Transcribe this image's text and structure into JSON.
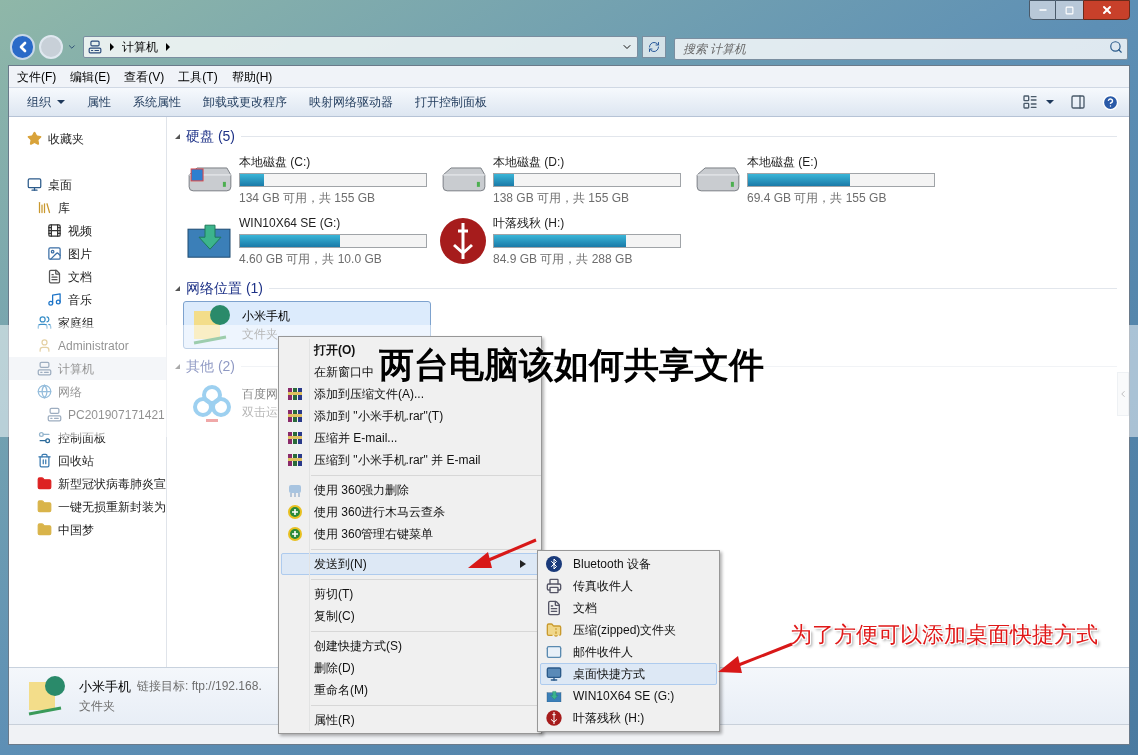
{
  "address": {
    "path": [
      "计算机"
    ]
  },
  "search": {
    "placeholder": "搜索 计算机"
  },
  "menu": [
    "文件(F)",
    "编辑(E)",
    "查看(V)",
    "工具(T)",
    "帮助(H)"
  ],
  "toolbar": [
    {
      "label": "组织",
      "kind": "dropdown"
    },
    {
      "label": "属性",
      "kind": "button"
    },
    {
      "label": "系统属性",
      "kind": "button"
    },
    {
      "label": "卸载或更改程序",
      "kind": "button"
    },
    {
      "label": "映射网络驱动器",
      "kind": "button"
    },
    {
      "label": "打开控制面板",
      "kind": "button"
    }
  ],
  "sidebar": {
    "items": [
      {
        "label": "收藏夹",
        "kind": "favorites",
        "selected": false
      },
      {
        "label": "桌面",
        "kind": "desktop",
        "selected": false,
        "children": [
          {
            "label": "库",
            "kind": "library",
            "selected": false,
            "children": [
              {
                "label": "视频",
                "kind": "video",
                "selected": false
              },
              {
                "label": "图片",
                "kind": "picture",
                "selected": false
              },
              {
                "label": "文档",
                "kind": "document",
                "selected": false
              },
              {
                "label": "音乐",
                "kind": "music",
                "selected": false
              }
            ]
          },
          {
            "label": "家庭组",
            "kind": "homegroup",
            "selected": false
          },
          {
            "label": "Administrator",
            "kind": "user",
            "selected": false
          },
          {
            "label": "计算机",
            "kind": "computer",
            "selected": true
          },
          {
            "label": "网络",
            "kind": "network",
            "selected": false,
            "children": [
              {
                "label": "PC201907171421",
                "kind": "computer",
                "selected": false
              }
            ]
          },
          {
            "label": "控制面板",
            "kind": "control",
            "selected": false
          },
          {
            "label": "回收站",
            "kind": "recycle",
            "selected": false
          },
          {
            "label": "新型冠状病毒肺炎宣",
            "kind": "redfolder",
            "selected": false
          },
          {
            "label": "一键无损重新封装为",
            "kind": "folder",
            "selected": false
          },
          {
            "label": "中国梦",
            "kind": "folder",
            "selected": false
          }
        ]
      }
    ]
  },
  "groups": [
    {
      "title": "硬盘 (5)",
      "kind": "drives",
      "items": [
        {
          "name": "本地磁盘 (C:)",
          "kind": "system",
          "level": 0.13,
          "free": "134 GB 可用，共 155 GB"
        },
        {
          "name": "本地磁盘 (D:)",
          "kind": "disk",
          "level": 0.11,
          "free": "138 GB 可用，共 155 GB"
        },
        {
          "name": "本地磁盘 (E:)",
          "kind": "disk",
          "level": 0.55,
          "free": "69.4 GB 可用，共 155 GB"
        },
        {
          "name": "WIN10X64 SE (G:)",
          "kind": "install",
          "level": 0.54,
          "free": "4.60 GB 可用，共 10.0 GB"
        },
        {
          "name": "叶落残秋 (H:)",
          "kind": "emblem",
          "level": 0.71,
          "free": "84.9 GB 可用，共 288 GB"
        }
      ]
    },
    {
      "title": "网络位置 (1)",
      "kind": "tiles",
      "items": [
        {
          "name": "小米手机",
          "type": "文件夹",
          "kind": "netfolder",
          "selected": true
        }
      ]
    },
    {
      "title": "其他 (2)",
      "kind": "tiles",
      "items": [
        {
          "name": "百度网",
          "type": "双击运",
          "kind": "cloud",
          "selected": false
        }
      ]
    }
  ],
  "details": {
    "name": "小米手机",
    "link": "链接目标: ftp://192.168.",
    "type": "文件夹"
  },
  "context_menu": {
    "sections": [
      [
        {
          "label": "打开(O)",
          "kind": "default",
          "selected": false
        },
        {
          "label": "在新窗口中",
          "kind": "plain",
          "selected": false
        },
        {
          "label": "添加到压缩文件(A)...",
          "kind": "rar",
          "selected": false
        },
        {
          "label": "添加到 \"小米手机.rar\"(T)",
          "kind": "rar",
          "selected": false
        },
        {
          "label": "压缩并 E-mail...",
          "kind": "rar",
          "selected": false
        },
        {
          "label": "压缩到 \"小米手机.rar\" 并 E-mail",
          "kind": "rar",
          "selected": false
        }
      ],
      [
        {
          "label": "使用 360强力删除",
          "kind": "shred",
          "selected": false
        },
        {
          "label": "使用 360进行木马云查杀",
          "kind": "guard",
          "selected": false
        },
        {
          "label": "使用 360管理右键菜单",
          "kind": "guard",
          "selected": false
        }
      ],
      [
        {
          "label": "发送到(N)",
          "kind": "submenu",
          "selected": true
        }
      ],
      [
        {
          "label": "剪切(T)",
          "kind": "plain",
          "selected": false
        },
        {
          "label": "复制(C)",
          "kind": "plain",
          "selected": false
        }
      ],
      [
        {
          "label": "创建快捷方式(S)",
          "kind": "plain",
          "selected": false
        },
        {
          "label": "删除(D)",
          "kind": "plain",
          "selected": false
        },
        {
          "label": "重命名(M)",
          "kind": "plain",
          "selected": false
        }
      ],
      [
        {
          "label": "属性(R)",
          "kind": "plain",
          "selected": false
        }
      ]
    ]
  },
  "submenu": {
    "items": [
      {
        "label": "Bluetooth 设备",
        "kind": "bluetooth",
        "selected": false
      },
      {
        "label": "传真收件人",
        "kind": "fax",
        "selected": false
      },
      {
        "label": "文档",
        "kind": "document",
        "selected": false
      },
      {
        "label": "压缩(zipped)文件夹",
        "kind": "zip",
        "selected": false
      },
      {
        "label": "邮件收件人",
        "kind": "mail",
        "selected": false
      },
      {
        "label": "桌面快捷方式",
        "kind": "desktop",
        "selected": true
      },
      {
        "label": "WIN10X64 SE (G:)",
        "kind": "install",
        "selected": false
      },
      {
        "label": "叶落残秋 (H:)",
        "kind": "emblem",
        "selected": false
      }
    ]
  },
  "banner": {
    "title": "两台电脑该如何共享文件"
  },
  "annotation": {
    "text": "为了方便可以添加桌面快捷方式"
  }
}
